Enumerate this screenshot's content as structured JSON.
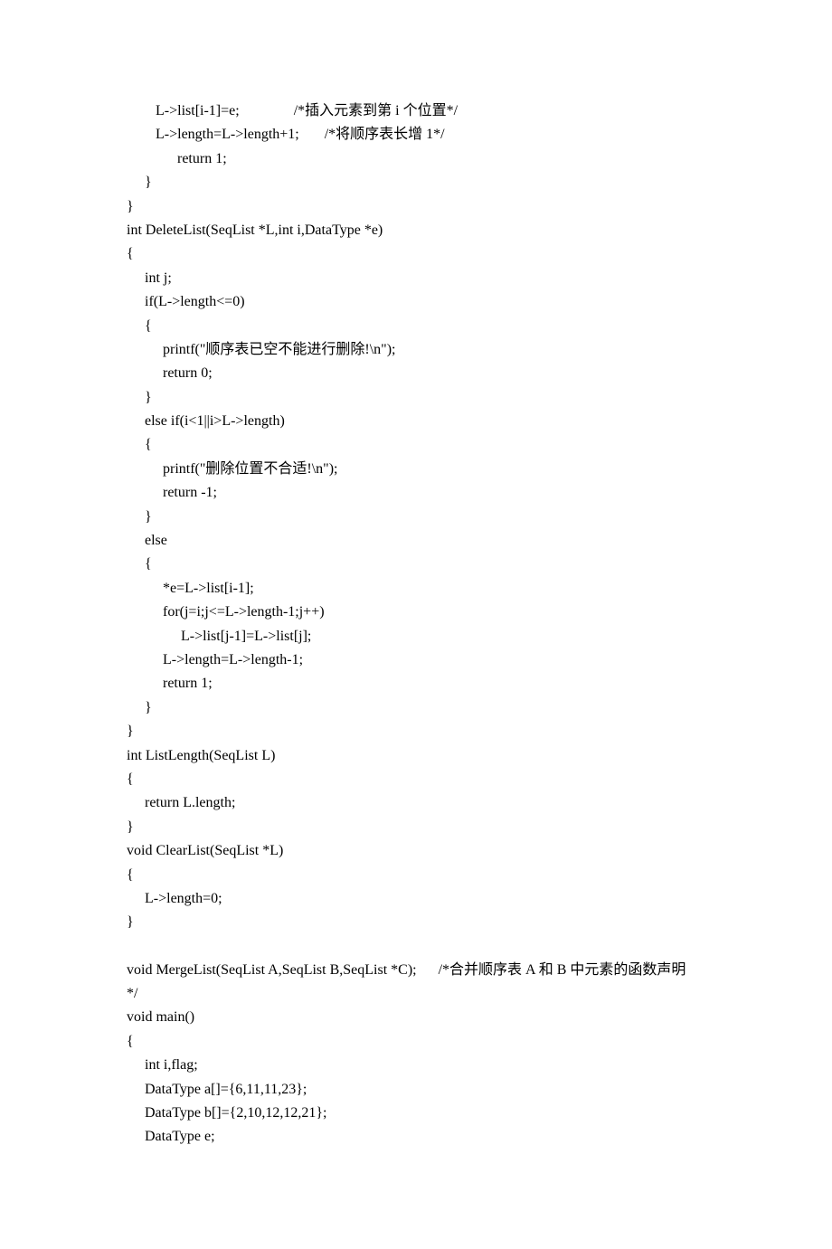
{
  "lines": [
    "        L->list[i-1]=e;               /*插入元素到第 i 个位置*/",
    "        L->length=L->length+1;       /*将顺序表长增 1*/",
    "              return 1;",
    "     }",
    "}",
    "int DeleteList(SeqList *L,int i,DataType *e)",
    "{",
    "     int j;",
    "     if(L->length<=0)",
    "     {",
    "          printf(\"顺序表已空不能进行删除!\\n\");",
    "          return 0;",
    "     }",
    "     else if(i<1||i>L->length)",
    "     {",
    "          printf(\"删除位置不合适!\\n\");",
    "          return -1;",
    "     }",
    "     else",
    "     {",
    "          *e=L->list[i-1];",
    "          for(j=i;j<=L->length-1;j++)",
    "               L->list[j-1]=L->list[j];",
    "          L->length=L->length-1;",
    "          return 1;",
    "     }",
    "}",
    "int ListLength(SeqList L)",
    "{",
    "     return L.length;",
    "}",
    "void ClearList(SeqList *L)",
    "{",
    "     L->length=0;",
    "}",
    "",
    "void MergeList(SeqList A,SeqList B,SeqList *C);      /*合并顺序表 A 和 B 中元素的函数声明",
    "*/",
    "void main()",
    "{",
    "     int i,flag;",
    "     DataType a[]={6,11,11,23};",
    "     DataType b[]={2,10,12,12,21};",
    "     DataType e;"
  ]
}
